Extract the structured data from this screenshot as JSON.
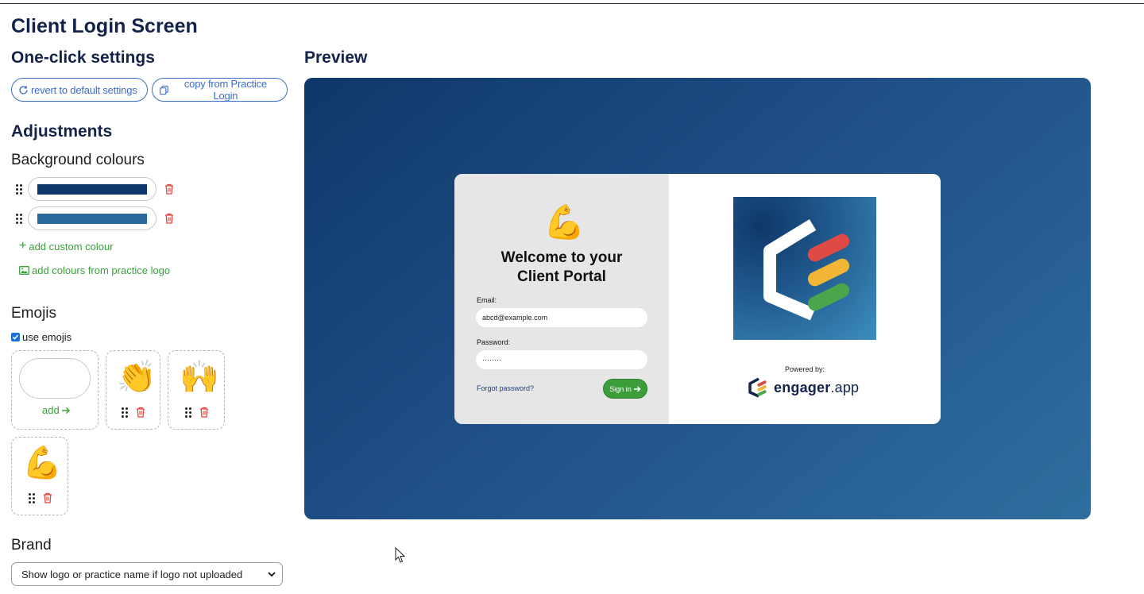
{
  "page_title": "Client Login Screen",
  "one_click": {
    "heading": "One-click settings",
    "revert_label": "revert to default settings",
    "copy_label": "copy from Practice Login"
  },
  "adjustments": {
    "heading": "Adjustments",
    "background_colours": {
      "heading": "Background colours",
      "colours": [
        "#0f3769",
        "#2a6a9a"
      ],
      "add_custom_label": "add custom colour",
      "add_from_logo_label": "add colours from practice logo"
    },
    "emojis": {
      "heading": "Emojis",
      "use_emojis_label": "use emojis",
      "use_emojis_checked": true,
      "add_label": "add",
      "items": [
        {
          "icon": "clapping-hands",
          "glyph": "👏"
        },
        {
          "icon": "raising-hands",
          "glyph": "🙌"
        },
        {
          "icon": "flexed-biceps",
          "glyph": "💪"
        }
      ]
    },
    "brand": {
      "heading": "Brand",
      "selected_option": "Show logo or practice name if logo not uploaded"
    }
  },
  "preview": {
    "heading": "Preview",
    "emoji": "💪",
    "welcome_line1": "Welcome to your",
    "welcome_line2": "Client Portal",
    "email_label": "Email:",
    "email_value": "abcd@example.com",
    "password_label": "Password:",
    "password_value": "········",
    "forgot_label": "Forgot password?",
    "signin_label": "Sign in",
    "powered_by": "Powered by:",
    "brand_name": "engager",
    "brand_suffix": ".app",
    "colors": {
      "gradient_start": "#0f3769",
      "gradient_end": "#2f6e9e",
      "accent_green": "#3b9e3b",
      "link_blue": "#3d6dc6"
    }
  }
}
